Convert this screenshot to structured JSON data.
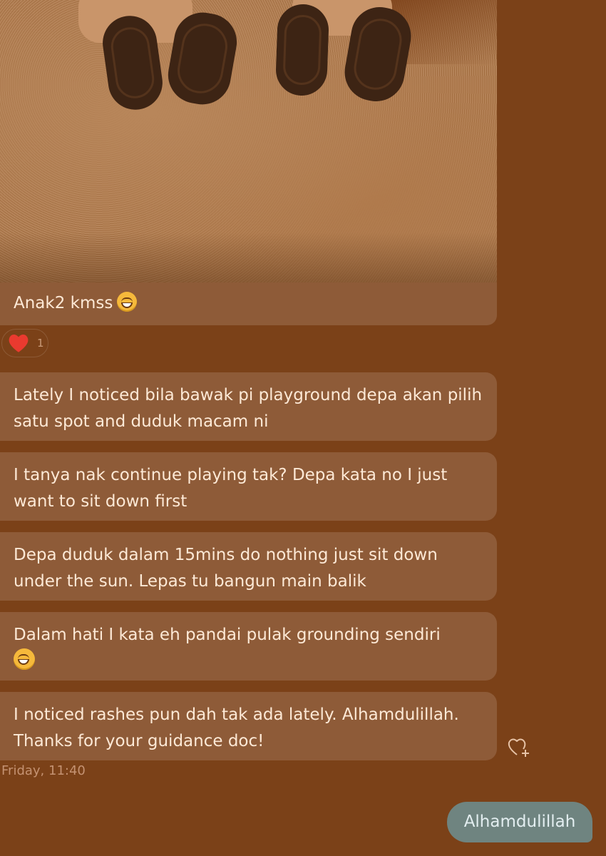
{
  "photo": {
    "alt_icon": "photo-of-children-feet"
  },
  "caption": {
    "text": "Anak2 kmss",
    "emoji": "grinning-face-icon"
  },
  "reaction": {
    "icon": "heart-icon",
    "count": "1",
    "color": "#ea3a2f"
  },
  "messages": [
    {
      "text": "Lately I noticed bila bawak pi playground depa akan pilih satu spot and duduk macam ni"
    },
    {
      "text": "I tanya nak continue playing tak? Depa kata no I just want to sit down first"
    },
    {
      "text": "Depa duduk dalam 15mins do nothing just sit down under the sun. Lepas tu bangun main balik"
    },
    {
      "text": "Dalam hati I kata eh pandai pulak grounding sendiri",
      "emoji": "laughing-face-icon"
    },
    {
      "text": "I noticed rashes pun dah tak ada lately. Alhamdulillah. Thanks for your guidance doc!"
    }
  ],
  "timestamp": "Friday, 11:40",
  "sent_message": {
    "text": "Alhamdulillah"
  },
  "colors": {
    "background": "#7b4118",
    "received_bubble": "#8e5b38",
    "sent_bubble": "#6f8480",
    "text": "#fde9d6"
  }
}
